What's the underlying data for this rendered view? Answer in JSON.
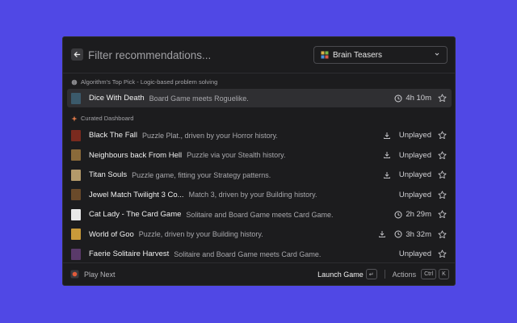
{
  "header": {
    "placeholder": "Filter recommendations...",
    "dropdown_value": "Brain Teasers"
  },
  "top_pick": {
    "label": "Algorithm's Top Pick - Logic-based problem solving",
    "item": {
      "title": "Dice With Death",
      "subtitle": "Board Game meets Roguelike.",
      "time": "4h 10m",
      "thumb_color": "#3b5a6b"
    }
  },
  "curated": {
    "label": "Curated Dashboard",
    "items": [
      {
        "title": "Black The Fall",
        "subtitle": "Puzzle Plat., driven by your Horror history.",
        "status": "Unplayed",
        "thumb_color": "#7a2a1e"
      },
      {
        "title": "Neighbours back From Hell",
        "subtitle": "Puzzle via your Stealth history.",
        "status": "Unplayed",
        "thumb_color": "#8a6a3a"
      },
      {
        "title": "Titan Souls",
        "subtitle": "Puzzle game, fitting your Strategy patterns.",
        "status": "Unplayed",
        "thumb_color": "#b49a6a"
      },
      {
        "title": "Jewel Match Twilight 3 Co...",
        "subtitle": "Match 3, driven by your Building history.",
        "status": "Unplayed",
        "thumb_color": "#6a4a2a"
      },
      {
        "title": "Cat Lady - The Card Game",
        "subtitle": "Solitaire and Board Game meets Card Game.",
        "time": "2h 29m",
        "thumb_color": "#e8e8e8"
      },
      {
        "title": "World of Goo",
        "subtitle": "Puzzle, driven by your Building history.",
        "time": "3h 32m",
        "thumb_color": "#c99a3a"
      },
      {
        "title": "Faerie Solitaire Harvest",
        "subtitle": "Solitaire and Board Game meets Card Game.",
        "status": "Unplayed",
        "thumb_color": "#5a3a6a"
      }
    ]
  },
  "footer": {
    "label": "Play Next",
    "launch": "Launch Game",
    "launch_key": "↵",
    "actions": "Actions",
    "actions_key1": "Ctrl",
    "actions_key2": "K"
  },
  "colors": {
    "background": "#5048e5",
    "window": "#1c1c1e",
    "selected_row": "#2f2f32"
  }
}
